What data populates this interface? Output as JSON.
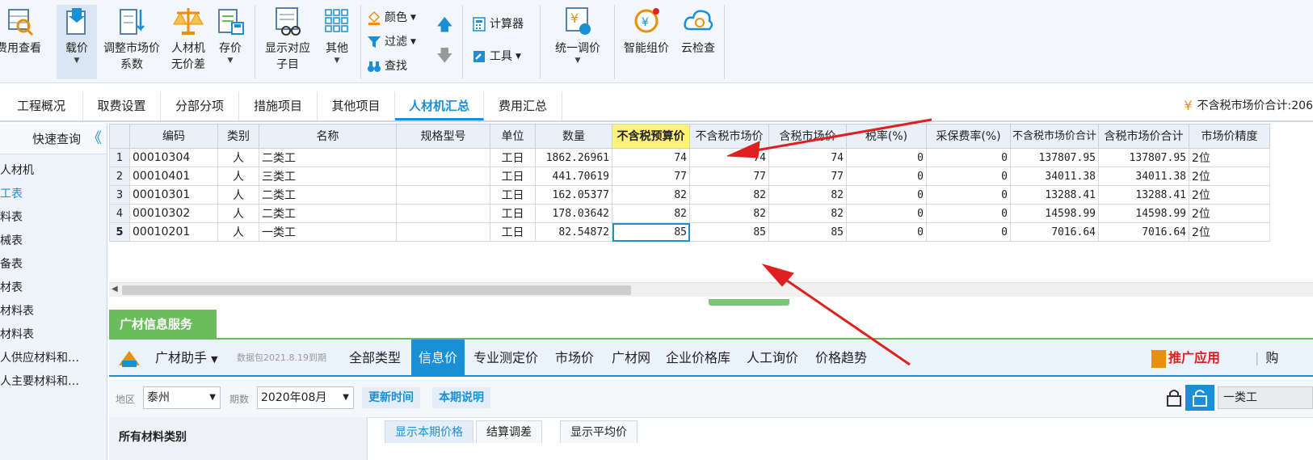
{
  "ribbon": {
    "buttons": [
      {
        "label": "费用查看",
        "icon": "magnifier-table-icon"
      },
      {
        "label": "载价",
        "icon": "load-price-icon"
      },
      {
        "label": "调整市场价\n系数",
        "icon": "adjust-coefficient-icon"
      },
      {
        "label": "人材机\n无价差",
        "icon": "scale-icon"
      },
      {
        "label": "存价",
        "icon": "save-price-icon"
      },
      {
        "label": "显示对应\n子目",
        "icon": "show-sub-item-icon"
      },
      {
        "label": "其他",
        "icon": "grid-icon"
      },
      {
        "label": "统一调价",
        "icon": "unified-price-icon"
      },
      {
        "label": "智能组价",
        "icon": "smart-price-icon"
      },
      {
        "label": "云检查",
        "icon": "cloud-check-icon"
      }
    ],
    "small": {
      "color": "颜色",
      "filter": "过滤",
      "find": "查找",
      "calculator": "计算器",
      "tools": "工具"
    }
  },
  "tabs": [
    "工程概况",
    "取费设置",
    "分部分项",
    "措施项目",
    "其他项目",
    "人材机汇总",
    "费用汇总"
  ],
  "active_tab": "人材机汇总",
  "tab_right_text": "不含税市场价合计:206",
  "left_panel": {
    "title": "快速查询",
    "items": [
      "人材机",
      "工表",
      "料表",
      "械表",
      "备表",
      "材表",
      "材料表",
      "材料表",
      "人供应材料和…",
      "人主要材料和…"
    ]
  },
  "grid": {
    "columns": [
      "",
      "编码",
      "类别",
      "名称",
      "规格型号",
      "单位",
      "数量",
      "不含税预算价",
      "不含税市场价",
      "含税市场价",
      "税率(%)",
      "采保费率(%)",
      "不含税市场价合计",
      "含税市场价合计",
      "市场价精度"
    ],
    "rows": [
      [
        "1",
        "00010304",
        "人",
        "二类工",
        "",
        "工日",
        "1862.26961",
        "74",
        "74",
        "74",
        "0",
        "0",
        "137807.95",
        "137807.95",
        "2位"
      ],
      [
        "2",
        "00010401",
        "人",
        "三类工",
        "",
        "工日",
        "441.70619",
        "77",
        "77",
        "77",
        "0",
        "0",
        "34011.38",
        "34011.38",
        "2位"
      ],
      [
        "3",
        "00010301",
        "人",
        "二类工",
        "",
        "工日",
        "162.05377",
        "82",
        "82",
        "82",
        "0",
        "0",
        "13288.41",
        "13288.41",
        "2位"
      ],
      [
        "4",
        "00010302",
        "人",
        "二类工",
        "",
        "工日",
        "178.03642",
        "82",
        "82",
        "82",
        "0",
        "0",
        "14598.99",
        "14598.99",
        "2位"
      ],
      [
        "5",
        "00010201",
        "人",
        "一类工",
        "",
        "工日",
        "82.54872",
        "85",
        "85",
        "85",
        "0",
        "0",
        "7016.64",
        "7016.64",
        "2位"
      ]
    ]
  },
  "info": {
    "tab_title": "广材信息服务",
    "assistant": "广材助手",
    "package_note": "数据包2021.8.19到期",
    "nav": [
      "全部类型",
      "信息价",
      "专业测定价",
      "市场价",
      "广材网",
      "企业价格库",
      "人工询价",
      "价格趋势"
    ],
    "active_nav": "信息价",
    "promo": "推广应用",
    "right_text": "购",
    "region_label": "地区",
    "region_value": "泰州",
    "period_label": "期数",
    "period_value": "2020年08月",
    "update_time_btn": "更新时间",
    "period_note_btn": "本期说明",
    "right_filter_value": "一类工",
    "category_title": "所有材料类别",
    "sub_tabs": [
      "显示本期价格",
      "结算调差",
      "显示平均价"
    ]
  },
  "colors": {
    "accent": "#1a8fd6",
    "green": "#6bbd5b",
    "highlight_header": "#fff27a",
    "annotation_arrow": "#e02020"
  }
}
